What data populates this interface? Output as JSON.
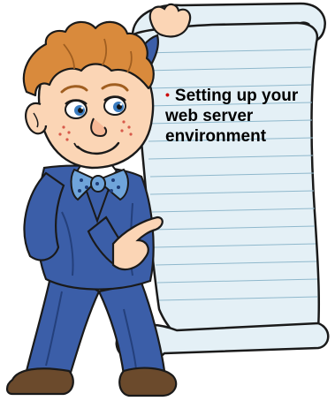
{
  "slide": {
    "bullet": "•",
    "text": "Setting up your web server environment"
  },
  "colors": {
    "scroll": "#e4f0f6",
    "scroll_lines": "#8fb8cc",
    "outline": "#1a1a1a",
    "suit": "#3b5ea8",
    "suit_shadow": "#24407c",
    "hair": "#d98a3c",
    "skin": "#fbd5b5",
    "bowtie": "#6fa4da",
    "shoes": "#6b4a2c",
    "bullet": "#cc0000"
  },
  "icons": [
    "scroll-icon",
    "boy-mascot-icon"
  ]
}
